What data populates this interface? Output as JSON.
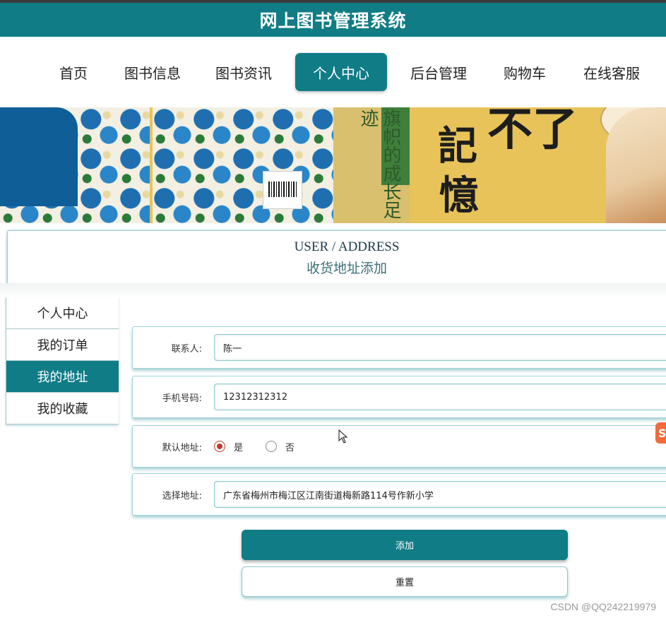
{
  "app": {
    "title": "网上图书管理系统"
  },
  "nav": {
    "items": [
      {
        "label": "首页"
      },
      {
        "label": "图书信息"
      },
      {
        "label": "图书资讯"
      },
      {
        "label": "个人中心",
        "active": true
      },
      {
        "label": "后台管理"
      },
      {
        "label": "购物车"
      },
      {
        "label": "在线客服"
      }
    ],
    "active_color": "#107c86"
  },
  "banner": {
    "spine_text": "旗帜的成长足迹",
    "calligraphy_1": "記",
    "calligraphy_2": "憶",
    "calligraphy_3": "不了"
  },
  "header": {
    "en": "USER / ADDRESS",
    "cn": "收货地址添加"
  },
  "sidebar": {
    "items": [
      {
        "label": "个人中心"
      },
      {
        "label": "我的订单"
      },
      {
        "label": "我的地址",
        "active": true
      },
      {
        "label": "我的收藏"
      }
    ]
  },
  "form": {
    "contact": {
      "label": "联系人:",
      "value": "陈一"
    },
    "phone": {
      "label": "手机号码:",
      "value": "12312312312"
    },
    "default": {
      "label": "默认地址:",
      "options": [
        "是",
        "否"
      ],
      "selected": "是"
    },
    "address": {
      "label": "选择地址:",
      "value": "广东省梅州市梅江区江南街道梅新路114号作新小学"
    }
  },
  "buttons": {
    "add": "添加",
    "reset": "重置"
  },
  "watermark": "CSDN @QQ242219979",
  "side_widget_glyph": "S",
  "colors": {
    "primary": "#107c86",
    "radio_selected": "#c0392b"
  }
}
